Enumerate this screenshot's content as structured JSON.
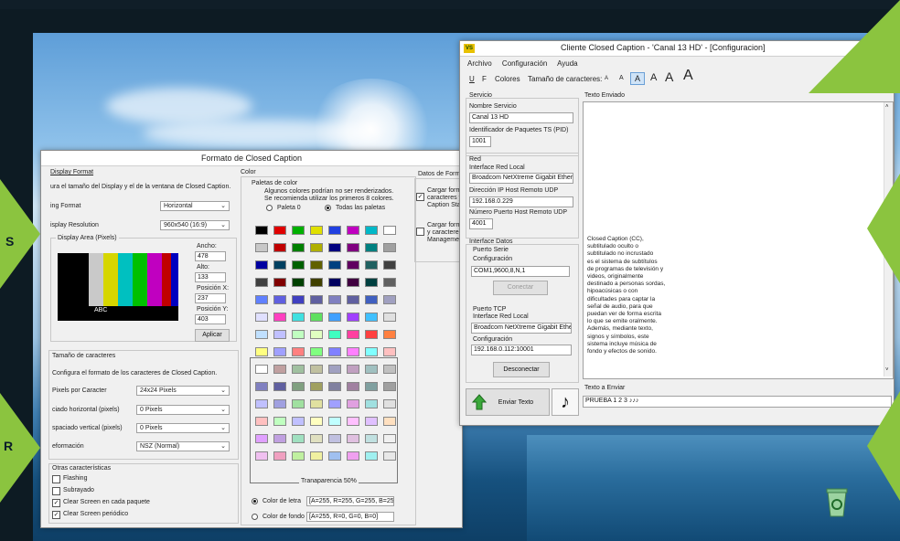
{
  "colors": {
    "accent": "#8bc43f",
    "sea": "#2a6d9d",
    "window_bg": "#f0f0f0"
  },
  "badges": [
    "S",
    "R"
  ],
  "format_window": {
    "title": "Formato de Closed Caption",
    "display_format": {
      "heading": "Display Format",
      "description": "ura el tamaño del Display y el de la ventana de Closed Caption.",
      "format_label": "ing Format",
      "format_value": "Horizontal",
      "resolution_label": "isplay Resolution",
      "resolution_value": "960x540 (16:9)",
      "area_heading": "Display Area (Pixels)",
      "ancho_label": "Ancho:",
      "ancho_value": "478",
      "alto_label": "Alto:",
      "alto_value": "133",
      "posx_label": "Posición X:",
      "posx_value": "237",
      "posy_label": "Posición Y:",
      "posy_value": "403",
      "preview_text": "ABC",
      "apply_label": "Aplicar"
    },
    "char_size": {
      "heading": "Tamaño de caracteres",
      "description": "Configura el formato de los caracteres de Closed Caption.",
      "pixels_label": "Pixels por Caracter",
      "pixels_value": "24x24 Pixels",
      "hspace_label": "ciado horizontal (pixels)",
      "hspace_value": "0 Pixels",
      "vspace_label": "spaciado vertical (pixels)",
      "vspace_value": "0 Pixels",
      "deform_label": "eformación",
      "deform_value": "NSZ (Normal)"
    },
    "other": {
      "heading": "Otras características",
      "items": [
        {
          "label": "Flashing",
          "checked": false
        },
        {
          "label": "Subrayado",
          "checked": false
        },
        {
          "label": "Clear Screen en cada paquete",
          "checked": true
        },
        {
          "label": "Clear Screen periódico",
          "checked": true
        }
      ]
    },
    "color": {
      "heading": "Color",
      "palette_heading": "Paletas de color",
      "note1": "Algunos colores podrían no ser renderizados.",
      "note2": "Se recomienda utilizar los primeros 8 colores.",
      "radio1": "Paleta 0",
      "radio2": "Todas las paletas",
      "transparency_label": "Tranaparencia 50%",
      "letter_label": "Color de letra",
      "letter_value": "[A=255, R=255, G=255, B=255]",
      "bg_label": "Color de fondo",
      "bg_value": "[A=255, R=0, G=0, B=0]"
    },
    "format_panel": {
      "heading": "Datos de Format",
      "item1_lines": [
        "Cargar format",
        "caracteres y",
        "Caption State"
      ],
      "item2_lines": [
        "Cargar format",
        "y caracteres",
        "Management"
      ]
    }
  },
  "client_window": {
    "title": "Cliente Closed Caption - 'Canal 13 HD' - [Configuracion]",
    "app_icon": "VS",
    "menu": [
      "Archivo",
      "Configuración",
      "Ayuda"
    ],
    "toolbar": {
      "u": "U",
      "f": "F",
      "colores": "Colores",
      "size_label": "Tamaño de caracteres:",
      "sizes": [
        "A",
        "A",
        "A",
        "A",
        "A",
        "A"
      ]
    },
    "servicio": {
      "heading": "Servicio",
      "name_label": "Nombre Servicio",
      "name_value": "Canal 13 HD",
      "pid_label": "Identificador de Paquetes TS (PID)",
      "pid_value": "1001"
    },
    "red": {
      "heading": "Red",
      "iface_label": "Interface Red Local",
      "iface_value": "Broadcom NetXtreme Gigabit Etherne",
      "ip_label": "Dirección IP Host Remoto UDP",
      "ip_value": "192.168.0.229",
      "port_label": "Número Puerto Host Remoto UDP",
      "port_value": "4001"
    },
    "interface": {
      "heading": "Interface Datos",
      "serial_label": "Puerto Serie",
      "serial_conf_label": "Configuración",
      "serial_conf_value": "COM1,9600,8,N,1",
      "connect_label": "Conectar",
      "tcp_label": "Puerto TCP",
      "tcp_iface_label": "Interface Red Local",
      "tcp_iface_value": "Broadcom NetXtreme Gigabit Ether",
      "tcp_conf_label": "Configuración",
      "tcp_conf_value": "192.168.0.112:10001",
      "disconnect_label": "Desconectar"
    },
    "sent": {
      "heading": "Texto Enviado",
      "lines": [
        "Closed Caption (CC),",
        "subtitulado oculto o",
        "subtitulado no incrustado",
        "es el sistema de subtítulos",
        "de programas de televisión y",
        "videos, originalmente",
        "destinado a personas sordas,",
        "hipoacúsicas o con",
        "dificultades para captar la",
        "señal de audio, para que",
        "puedan ver de forma escrita",
        "lo que se emite oralmente.",
        "Además, mediante texto,",
        "signos y símbolos, este",
        "sistema incluye música de",
        "fondo y efectos de sonido."
      ]
    },
    "send": {
      "label": "Enviar Texto",
      "input_heading": "Texto a Enviar",
      "input_value": "PRUEBA 1 2 3 ♪♪♪"
    }
  }
}
